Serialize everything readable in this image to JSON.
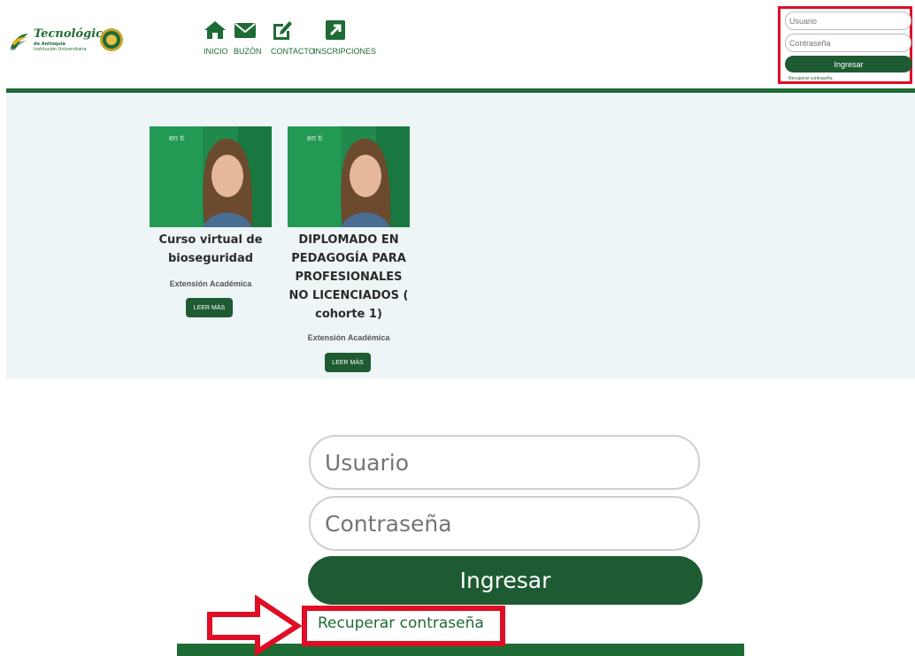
{
  "brand": {
    "title": "Tecnológico",
    "subtitle_1": "de Antioquia",
    "subtitle_2": "Institución Universitaria",
    "color": "#1e6b35"
  },
  "nav": [
    {
      "label": "INICIO",
      "icon": "home-icon"
    },
    {
      "label": "BUZÓN",
      "icon": "envelope-icon"
    },
    {
      "label": "CONTACTO",
      "icon": "edit-icon"
    },
    {
      "label": "INSCRIPCIONES",
      "icon": "external-link-icon"
    }
  ],
  "login": {
    "user_placeholder": "Usuario",
    "password_placeholder": "Contraseña",
    "submit_label": "Ingresar",
    "recover_label": "Recuperar contraseña"
  },
  "cards": [
    {
      "image_tag": "en ti",
      "title_lines": [
        "Curso virtual de",
        "bioseguridad"
      ],
      "category": "Extensión Académica",
      "button_label": "LEER MÁS"
    },
    {
      "image_tag": "en ti",
      "title_lines": [
        "DIPLOMADO EN",
        "PEDAGOGÍA PARA",
        "PROFESIONALES",
        "NO LICENCIADOS (",
        "cohorte 1)"
      ],
      "category": "Extensión Académica",
      "button_label": "LEER MÁS"
    }
  ],
  "zoom": {
    "user_placeholder": "Usuario",
    "password_placeholder": "Contraseña",
    "submit_label": "Ingresar",
    "recover_label": "Recuperar contraseña"
  },
  "colors": {
    "primary": "#1e5b32",
    "highlight": "#e00d25",
    "panel": "#eef5f7"
  }
}
